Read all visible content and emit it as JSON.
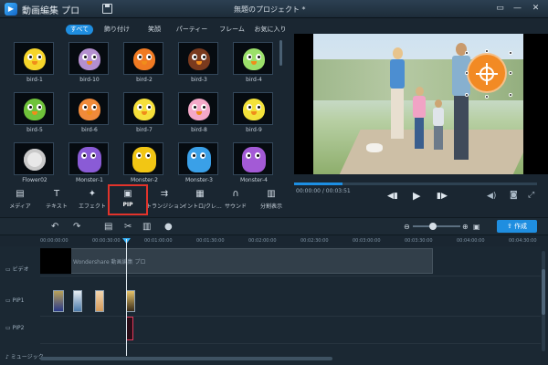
{
  "window": {
    "app_title": "動画編集 プロ",
    "project_title": "無題のプロジェクト *"
  },
  "library": {
    "tabs": [
      "すべて",
      "飾り付け",
      "笑顔",
      "パーティー",
      "フレーム",
      "お気に入り"
    ],
    "active_tab": "すべて",
    "items": [
      {
        "label": "bird-1",
        "color": "#f6d52a",
        "kind": "bird"
      },
      {
        "label": "bird-10",
        "color": "#b48fd0",
        "kind": "bird"
      },
      {
        "label": "bird-2",
        "color": "#f07a22",
        "kind": "bird"
      },
      {
        "label": "bird-3",
        "color": "#7a3a1e",
        "kind": "bird"
      },
      {
        "label": "bird-4",
        "color": "#9be06a",
        "kind": "bird"
      },
      {
        "label": "bird-5",
        "color": "#6fc23a",
        "kind": "bird"
      },
      {
        "label": "bird-6",
        "color": "#f08a3a",
        "kind": "bird"
      },
      {
        "label": "bird-7",
        "color": "#f6e03a",
        "kind": "bird"
      },
      {
        "label": "bird-8",
        "color": "#f4a8c8",
        "kind": "bird"
      },
      {
        "label": "bird-9",
        "color": "#f3e23a",
        "kind": "bird"
      },
      {
        "label": "Flower02",
        "color": "#e8e8e8",
        "kind": "flower"
      },
      {
        "label": "Monster-1",
        "color": "#8a5bd6",
        "kind": "monster"
      },
      {
        "label": "Monster-2",
        "color": "#f2c614",
        "kind": "monster"
      },
      {
        "label": "Monster-3",
        "color": "#3aa0e8",
        "kind": "monster"
      },
      {
        "label": "Monster-4",
        "color": "#a35ad6",
        "kind": "monster"
      }
    ]
  },
  "toolbar": {
    "buttons": [
      {
        "label": "メディア",
        "icon": "media-icon",
        "glyph": "▤"
      },
      {
        "label": "テキスト",
        "icon": "text-icon",
        "glyph": "T"
      },
      {
        "label": "エフェクト",
        "icon": "effect-wand-icon",
        "glyph": "✦"
      },
      {
        "label": "PIP",
        "icon": "pip-icon",
        "glyph": "▣"
      },
      {
        "label": "トランジション",
        "icon": "transition-icon",
        "glyph": "⇉"
      },
      {
        "label": "イントロ/クレ...",
        "icon": "intro-credits-icon",
        "glyph": "▦"
      },
      {
        "label": "サウンド",
        "icon": "headphones-icon",
        "glyph": "∩"
      },
      {
        "label": "分割表示",
        "icon": "split-screen-icon",
        "glyph": "▥"
      }
    ],
    "selected": "PIP"
  },
  "player": {
    "timecode": "00:00:00 / 00:03:51",
    "progress": 0.2
  },
  "editbar": {
    "create_label": "作成"
  },
  "ruler": {
    "ticks": [
      "00:00:00:00",
      "00:00:30:00",
      "00:01:00:00",
      "00:01:30:00",
      "00:02:00:00",
      "00:02:30:00",
      "00:03:00:00",
      "00:03:30:00",
      "00:04:00:00",
      "00:04:30:00"
    ]
  },
  "timeline": {
    "tracks": [
      "ビデオ",
      "PIP1",
      "PIP2",
      "ミュージック"
    ],
    "video_clip_text": "Wondershare 動画編集 プロ"
  },
  "colors": {
    "accent": "#1f8ee0",
    "selection": "#e2332b"
  }
}
